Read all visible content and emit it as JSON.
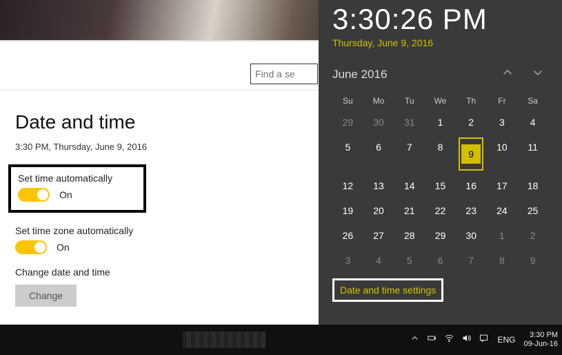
{
  "search": {
    "placeholder": "Find a se"
  },
  "settings": {
    "title": "Date and time",
    "current": "3:30 PM, Thursday, June 9, 2016",
    "auto_time": {
      "label": "Set time automatically",
      "state": "On"
    },
    "auto_tz": {
      "label": "Set time zone automatically",
      "state": "On"
    },
    "change": {
      "label": "Change date and time",
      "button": "Change"
    }
  },
  "flyout": {
    "time": "3:30:26 PM",
    "date": "Thursday, June 9, 2016",
    "month": "June 2016",
    "dow": [
      "Su",
      "Mo",
      "Tu",
      "We",
      "Th",
      "Fr",
      "Sa"
    ],
    "weeks": [
      [
        {
          "n": "29",
          "o": true
        },
        {
          "n": "30",
          "o": true
        },
        {
          "n": "31",
          "o": true
        },
        {
          "n": "1"
        },
        {
          "n": "2"
        },
        {
          "n": "3"
        },
        {
          "n": "4"
        }
      ],
      [
        {
          "n": "5"
        },
        {
          "n": "6"
        },
        {
          "n": "7"
        },
        {
          "n": "8"
        },
        {
          "n": "9",
          "today": true
        },
        {
          "n": "10"
        },
        {
          "n": "11"
        }
      ],
      [
        {
          "n": "12"
        },
        {
          "n": "13"
        },
        {
          "n": "14"
        },
        {
          "n": "15"
        },
        {
          "n": "16"
        },
        {
          "n": "17"
        },
        {
          "n": "18"
        }
      ],
      [
        {
          "n": "19"
        },
        {
          "n": "20"
        },
        {
          "n": "21"
        },
        {
          "n": "22"
        },
        {
          "n": "23"
        },
        {
          "n": "24"
        },
        {
          "n": "25"
        }
      ],
      [
        {
          "n": "26"
        },
        {
          "n": "27"
        },
        {
          "n": "28"
        },
        {
          "n": "29"
        },
        {
          "n": "30"
        },
        {
          "n": "1",
          "o": true
        },
        {
          "n": "2",
          "o": true
        }
      ],
      [
        {
          "n": "3",
          "o": true
        },
        {
          "n": "4",
          "o": true
        },
        {
          "n": "5",
          "o": true
        },
        {
          "n": "6",
          "o": true
        },
        {
          "n": "7",
          "o": true
        },
        {
          "n": "8",
          "o": true
        },
        {
          "n": "9",
          "o": true
        }
      ]
    ],
    "link": "Date and time settings"
  },
  "taskbar": {
    "lang": "ENG",
    "time": "3:30 PM",
    "date": "09-Jun-16"
  }
}
